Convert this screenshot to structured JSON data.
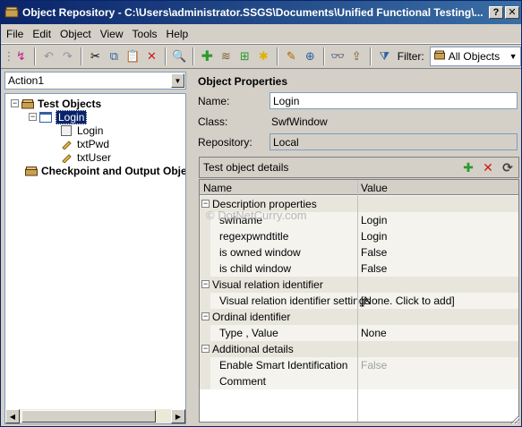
{
  "window": {
    "title": "Object Repository - C:\\Users\\administrator.SSGS\\Documents\\Unified Functional Testing\\...",
    "controls": {
      "help": "?",
      "close": "✕"
    }
  },
  "menu": [
    {
      "label": "File"
    },
    {
      "label": "Edit"
    },
    {
      "label": "Object"
    },
    {
      "label": "View"
    },
    {
      "label": "Tools"
    },
    {
      "label": "Help"
    }
  ],
  "toolbar": {
    "filter_label": "Filter:",
    "filter_value": "All Objects"
  },
  "left": {
    "action_combo": "Action1",
    "tree": [
      {
        "label": "Test Objects"
      },
      {
        "label": "Login"
      },
      {
        "label": "Login"
      },
      {
        "label": "txtPwd"
      },
      {
        "label": "txtUser"
      },
      {
        "label": "Checkpoint and Output Objec"
      }
    ]
  },
  "right": {
    "section_title": "Object Properties",
    "name_label": "Name:",
    "name_value": "Login",
    "class_label": "Class:",
    "class_value": "SwfWindow",
    "repository_label": "Repository:",
    "repository_value": "Local",
    "details_title": "Test object details",
    "grid": {
      "col_name": "Name",
      "col_value": "Value",
      "rows": [
        {
          "name": "Description properties",
          "value": ""
        },
        {
          "name": "swfname",
          "value": "Login"
        },
        {
          "name": "regexpwndtitle",
          "value": "Login"
        },
        {
          "name": "is owned window",
          "value": "False"
        },
        {
          "name": "is child window",
          "value": "False"
        },
        {
          "name": "Visual relation identifier",
          "value": ""
        },
        {
          "name": "Visual relation identifier settings",
          "value": "[None. Click to add]"
        },
        {
          "name": "Ordinal identifier",
          "value": ""
        },
        {
          "name": "Type , Value",
          "value": "None"
        },
        {
          "name": "Additional details",
          "value": ""
        },
        {
          "name": "Enable Smart Identification",
          "value": "False"
        },
        {
          "name": "Comment",
          "value": ""
        }
      ]
    },
    "watermark": "© DotNetCurry.com"
  },
  "colors": {
    "title_bar_start": "#0a246a",
    "title_bar_end": "#3a6ea5",
    "selection": "#0a246a",
    "add_icon": "#2e9a2e",
    "delete_icon": "#cc1a1a"
  }
}
